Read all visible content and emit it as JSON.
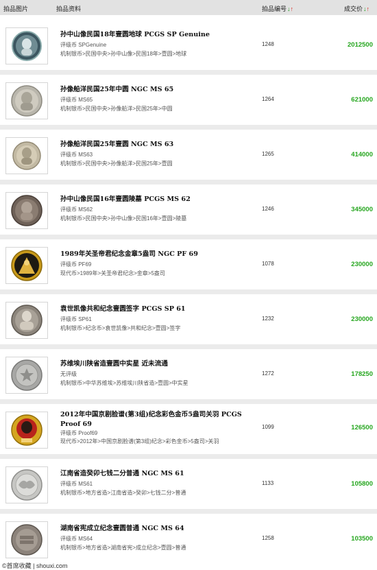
{
  "header": {
    "col_image": "拍品图片",
    "col_info": "拍品资料",
    "col_lot": "拍品编号",
    "col_price": "成交价",
    "sort_down": "↓",
    "sort_up": "↑"
  },
  "items": [
    {
      "title": "孙中山像民国18年壹圆地球 PCGS SP Genuine",
      "grade": "评级币 SPGenuine",
      "category": "机制银币>民国中央>孙中山像>民国18年>壹圆>地球",
      "lot": "1248",
      "price": "2012500"
    },
    {
      "title": "孙像船洋民国25年中圆 NGC MS 65",
      "grade": "评级币 MS65",
      "category": "机制银币>民国中央>孙像船洋>民国25年>中圆",
      "lot": "1264",
      "price": "621000"
    },
    {
      "title": "孙像船洋民国25年壹圆 NGC MS 63",
      "grade": "评级币 MS63",
      "category": "机制银币>民国中央>孙像船洋>民国25年>壹圆",
      "lot": "1265",
      "price": "414000"
    },
    {
      "title": "孙中山像民国16年壹圆陵墓 PCGS MS 62",
      "grade": "评级币 MS62",
      "category": "机制银币>民国中央>孙中山像>民国16年>壹圆>陵墓",
      "lot": "1246",
      "price": "345000"
    },
    {
      "title": "1989年关圣帝君纪念金章5盎司 NGC PF 69",
      "grade": "评级币 PF69",
      "category": "现代币>1989年>关圣帝君纪念>金章>5盎司",
      "lot": "1078",
      "price": "230000"
    },
    {
      "title": "袁世凯像共和纪念壹圆签字 PCGS SP 61",
      "grade": "评级币 SP61",
      "category": "机制银币>纪念币>袁世凯像>共和纪念>壹圆>签字",
      "lot": "1232",
      "price": "230000"
    },
    {
      "title": "苏维埃川陕省造壹圆中实星 近未流通",
      "grade": "无评级",
      "category": "机制银币>中华苏维埃>苏维埃川陕省造>壹圆>中实星",
      "lot": "1272",
      "price": "178250"
    },
    {
      "title": "2012年中国京剧脸谱(第3组)纪念彩色金币5盎司关羽 PCGS Proof 69",
      "grade": "评级币 Proof69",
      "category": "现代币>2012年>中国京剧脸谱(第3组)纪念>彩色金币>5盎司>关羽",
      "lot": "1099",
      "price": "126500"
    },
    {
      "title": "江南省造癸卯七钱二分普通 NGC MS 61",
      "grade": "评级币 MS61",
      "category": "机制银币>地方省造>江南省造>癸卯>七钱二分>普通",
      "lot": "1133",
      "price": "105800"
    },
    {
      "title": "湖南省宪成立纪念壹圆普通 NGC MS 64",
      "grade": "评级币 MS64",
      "category": "机制银币>地方省造>湖南省宪>成立纪念>壹圆>普通",
      "lot": "1258",
      "price": "103500"
    }
  ],
  "footer": {
    "watermark": "©首席收藏 | shouxi.com"
  },
  "colors": {
    "price": "#26a61f",
    "header_bg": "#e2e2e2",
    "sort_green": "#1a9a1a",
    "sort_red": "#d8261e"
  }
}
